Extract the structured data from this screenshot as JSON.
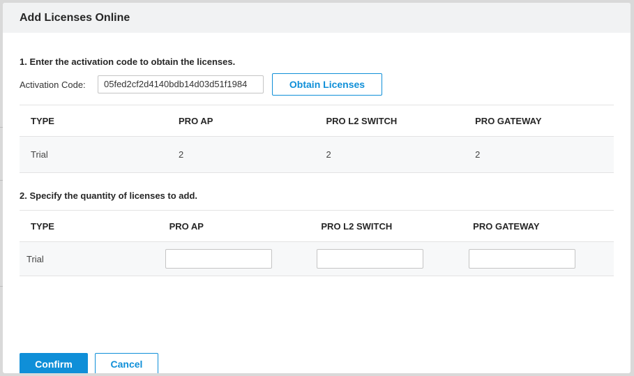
{
  "dialog": {
    "title": "Add Licenses Online",
    "step1_title": "1. Enter the activation code to obtain the licenses.",
    "activation_label": "Activation Code:",
    "activation_value": "05fed2cf2d4140bdb14d03d51f1984",
    "obtain_button": "Obtain Licenses",
    "step2_title": "2. Specify the quantity of licenses to add.",
    "confirm_button": "Confirm",
    "cancel_button": "Cancel"
  },
  "obtained_table": {
    "headers": [
      "TYPE",
      "PRO AP",
      "PRO L2 SWITCH",
      "PRO GATEWAY"
    ],
    "rows": [
      [
        "Trial",
        "2",
        "2",
        "2"
      ]
    ]
  },
  "quantity_table": {
    "headers": [
      "TYPE",
      "PRO AP",
      "PRO L2 SWITCH",
      "PRO GATEWAY"
    ],
    "rows": [
      {
        "type": "Trial",
        "pro_ap": "",
        "pro_l2_switch": "",
        "pro_gateway": ""
      }
    ]
  },
  "colors": {
    "accent": "#0f8fd8",
    "header_bg": "#f1f2f3",
    "row_bg": "#f7f8f9"
  }
}
